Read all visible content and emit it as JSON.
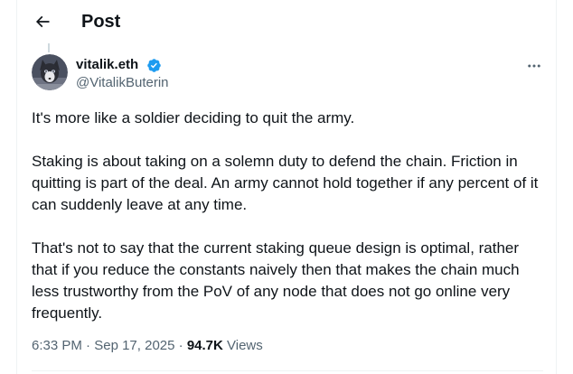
{
  "header": {
    "title": "Post",
    "back_icon": "arrow-left-icon"
  },
  "author": {
    "name": "vitalik.eth",
    "handle": "@VitalikButerin",
    "verified": true,
    "verified_color": "#1d9bf0",
    "avatar_icon": "avatar-image"
  },
  "post": {
    "paragraphs": [
      "It's more like a soldier deciding to quit the army.",
      "Staking is about taking on a solemn duty to defend the chain. Friction in quitting is part of the deal. An army cannot hold together if any percent of it can suddenly leave at any time.",
      "That's not to say that the current staking queue design is optimal, rather that if you reduce the constants naively then that makes the chain much less trustworthy from the PoV of any node that does not go online very frequently."
    ],
    "time": "6:33 PM",
    "separator": "·",
    "date": "Sep 17, 2025",
    "views_count": "94.7K",
    "views_label": "Views"
  },
  "colors": {
    "text_primary": "#0f1419",
    "text_secondary": "#536471",
    "border": "#eff3f4"
  }
}
